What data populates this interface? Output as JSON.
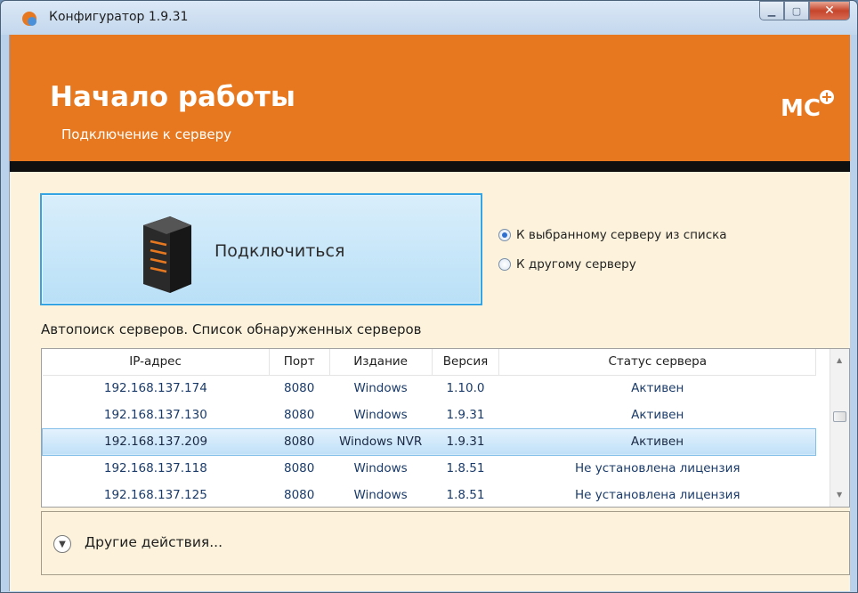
{
  "window": {
    "title": "Конфигуратор 1.9.31"
  },
  "header": {
    "title": "Начало работы",
    "subtitle": "Подключение к серверу",
    "logo": "MC"
  },
  "connect": {
    "label": "Подключиться"
  },
  "options": [
    {
      "label": "К выбранному серверу из списка",
      "checked": true
    },
    {
      "label": "К другому серверу",
      "checked": false
    }
  ],
  "autosearch": {
    "label": "Автопоиск серверов. Список обнаруженных серверов"
  },
  "table": {
    "columns": [
      "IP-адрес",
      "Порт",
      "Издание",
      "Версия",
      "Статус сервера"
    ],
    "rows": [
      [
        "192.168.137.174",
        "8080",
        "Windows",
        "1.10.0",
        "Активен"
      ],
      [
        "192.168.137.130",
        "8080",
        "Windows",
        "1.9.31",
        "Активен"
      ],
      [
        "192.168.137.209",
        "8080",
        "Windows NVR",
        "1.9.31",
        "Активен"
      ],
      [
        "192.168.137.118",
        "8080",
        "Windows",
        "1.8.51",
        "Не установлена лицензия"
      ],
      [
        "192.168.137.125",
        "8080",
        "Windows",
        "1.8.51",
        "Не установлена лицензия"
      ]
    ],
    "selected_row": 3
  },
  "actions": {
    "label": "Другие действия..."
  },
  "colors": {
    "header": "#e8781f",
    "selection": "#bfe0f8",
    "background": "#fdf3dc"
  },
  "icons": [
    "app-icon",
    "minimize-icon",
    "maximize-icon",
    "close-icon",
    "server-icon",
    "chevron-down-icon"
  ]
}
